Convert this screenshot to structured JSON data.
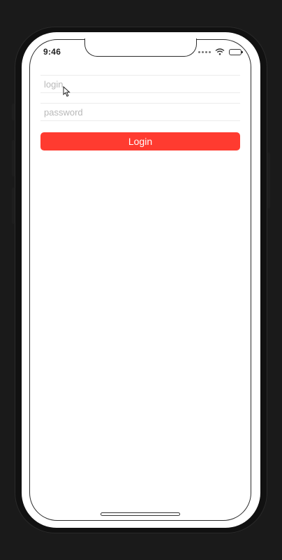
{
  "status_bar": {
    "time": "9:46",
    "icons": [
      "signal-dots-icon",
      "wifi-icon",
      "battery-icon"
    ]
  },
  "form": {
    "login_placeholder": "login",
    "login_value": "",
    "password_placeholder": "password",
    "password_value": "",
    "submit_label": "Login"
  },
  "colors": {
    "accent": "#ff3b30",
    "background": "#1a1a1a",
    "screen": "#ffffff"
  }
}
